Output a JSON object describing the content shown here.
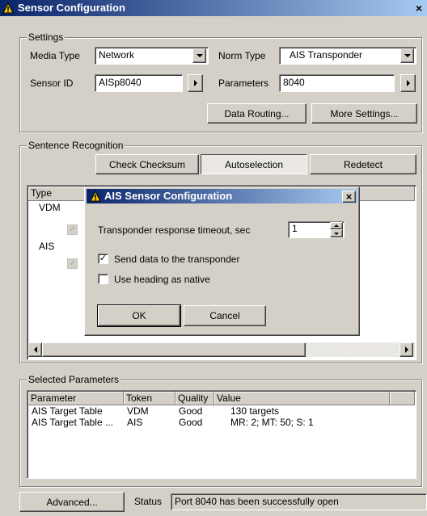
{
  "window": {
    "title": "Sensor Configuration",
    "close": "×"
  },
  "settings": {
    "group_label": "Settings",
    "media_type_label": "Media Type",
    "media_type_value": "Network",
    "norm_type_label": "Norm Type",
    "norm_type_value": "AIS Transponder",
    "sensor_id_label": "Sensor ID",
    "sensor_id_value": "AISp8040",
    "parameters_label": "Parameters",
    "parameters_value": "8040",
    "data_routing_button": "Data Routing...",
    "more_settings_button": "More Settings..."
  },
  "sentence_recognition": {
    "group_label": "Sentence Recognition",
    "check_checksum_button": "Check Checksum",
    "autoselection_button": "Autoselection",
    "redetect_button": "Redetect",
    "type_header": "Type",
    "rows": [
      {
        "type": "VDM",
        "checked": true
      },
      {
        "type": "AIS",
        "checked": true
      }
    ]
  },
  "dialog": {
    "title": "AIS Sensor Configuration",
    "close": "×",
    "timeout_label": "Transponder response timeout, sec",
    "timeout_value": "1",
    "send_data_label": "Send data to the transponder",
    "send_data_checked": true,
    "use_heading_label": "Use heading as native",
    "use_heading_checked": false,
    "ok_button": "OK",
    "cancel_button": "Cancel"
  },
  "selected_parameters": {
    "group_label": "Selected Parameters",
    "columns": [
      "Parameter",
      "Token",
      "Quality",
      "Value"
    ],
    "rows": [
      [
        "AIS Target Table",
        "VDM",
        "Good",
        "130 targets"
      ],
      [
        "AIS Target Table ...",
        "AIS",
        "Good",
        "MR: 2; MT: 50; S: 1"
      ]
    ]
  },
  "footer": {
    "advanced_button": "Advanced...",
    "status_label": "Status",
    "status_value": "Port 8040 has been successfully open"
  },
  "icons": {
    "app_icon": "warning-triangle-icon"
  },
  "colors": {
    "title_start": "#0a246a",
    "title_end": "#a6caf0",
    "face": "#d4d0c8"
  }
}
